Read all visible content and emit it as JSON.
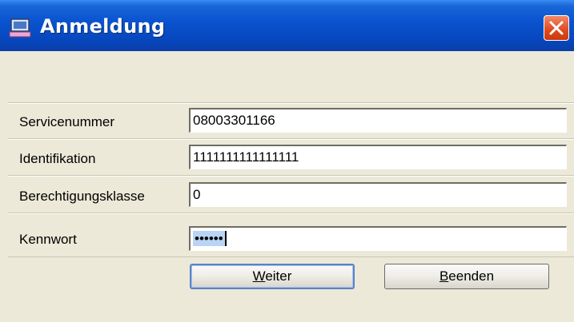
{
  "window": {
    "title": "Anmeldung"
  },
  "form": {
    "fields": [
      {
        "label": "Servicenummer",
        "value": "08003301166"
      },
      {
        "label": "Identifikation",
        "value": "1111111111111111"
      },
      {
        "label": "Berechtigungsklasse",
        "value": "0"
      },
      {
        "label": "Kennwort",
        "value": "••••••"
      }
    ]
  },
  "buttons": {
    "weiter": {
      "mnemonic": "W",
      "rest": "eiter"
    },
    "beenden": {
      "mnemonic": "B",
      "rest": "eenden"
    }
  },
  "colors": {
    "titlebar": "#0a54d0",
    "close": "#e04a1c",
    "selection": "#b9d4f4",
    "background": "#ece9d8"
  }
}
